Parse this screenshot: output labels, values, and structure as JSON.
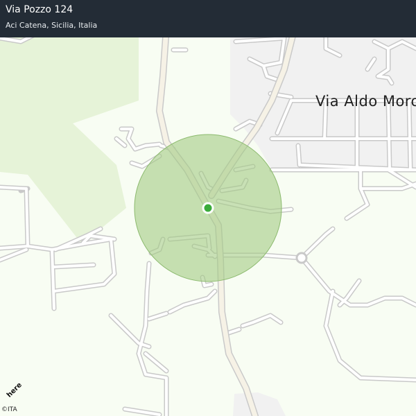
{
  "header": {
    "title": "Via Pozzo 124",
    "subtitle": "Aci Catena, Sicilia, Italia"
  },
  "map": {
    "street_label": "Via Aldo Moro",
    "attribution": "©ITA",
    "brand": "here",
    "colors": {
      "background": "#f8fdf3",
      "park": "#e6f3d8",
      "urban_area": "#f1f1f1",
      "road_casing": "#c9c9c9",
      "road_fill": "#ffffff",
      "main_road_fill": "#f6f2e6",
      "accuracy_circle": "#a4cc84",
      "location_dot": "#3bab3b",
      "header_bg": "#232c36"
    }
  }
}
